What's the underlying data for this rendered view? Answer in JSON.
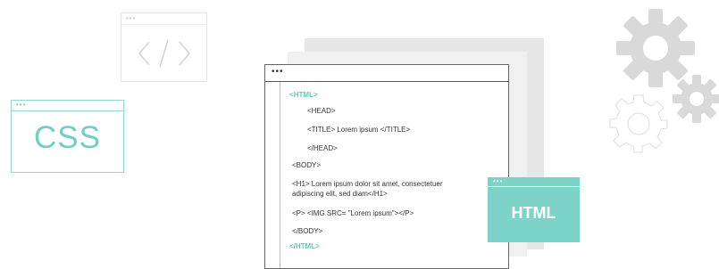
{
  "small_window": {
    "dots": "•••",
    "symbol": "< / >"
  },
  "css_window": {
    "dots": "•••",
    "label": "CSS"
  },
  "main_window": {
    "dots": "•••",
    "lines": [
      "<HTML>",
      "<HEAD>",
      "<TITLE> Lorem ipsum </TITLE>",
      "</HEAD>",
      "<BODY>",
      "<H1> Lorem ipsum dolor sit amet, consectetuer",
      "adipiscing elit, sed diam</H1>",
      "<P> <IMG SRC= \"Lorem ipsum\"></P>",
      "</BODY>",
      "</HTML>"
    ]
  },
  "html_badge": {
    "dots": "•••",
    "label": "HTML"
  },
  "colors": {
    "teal": "#7dd3c7",
    "teal_text": "#5fc9b9",
    "gear": "#d9d9d9"
  },
  "icons": [
    "code-window-icon",
    "gear-icon",
    "gear-outline-icon"
  ]
}
